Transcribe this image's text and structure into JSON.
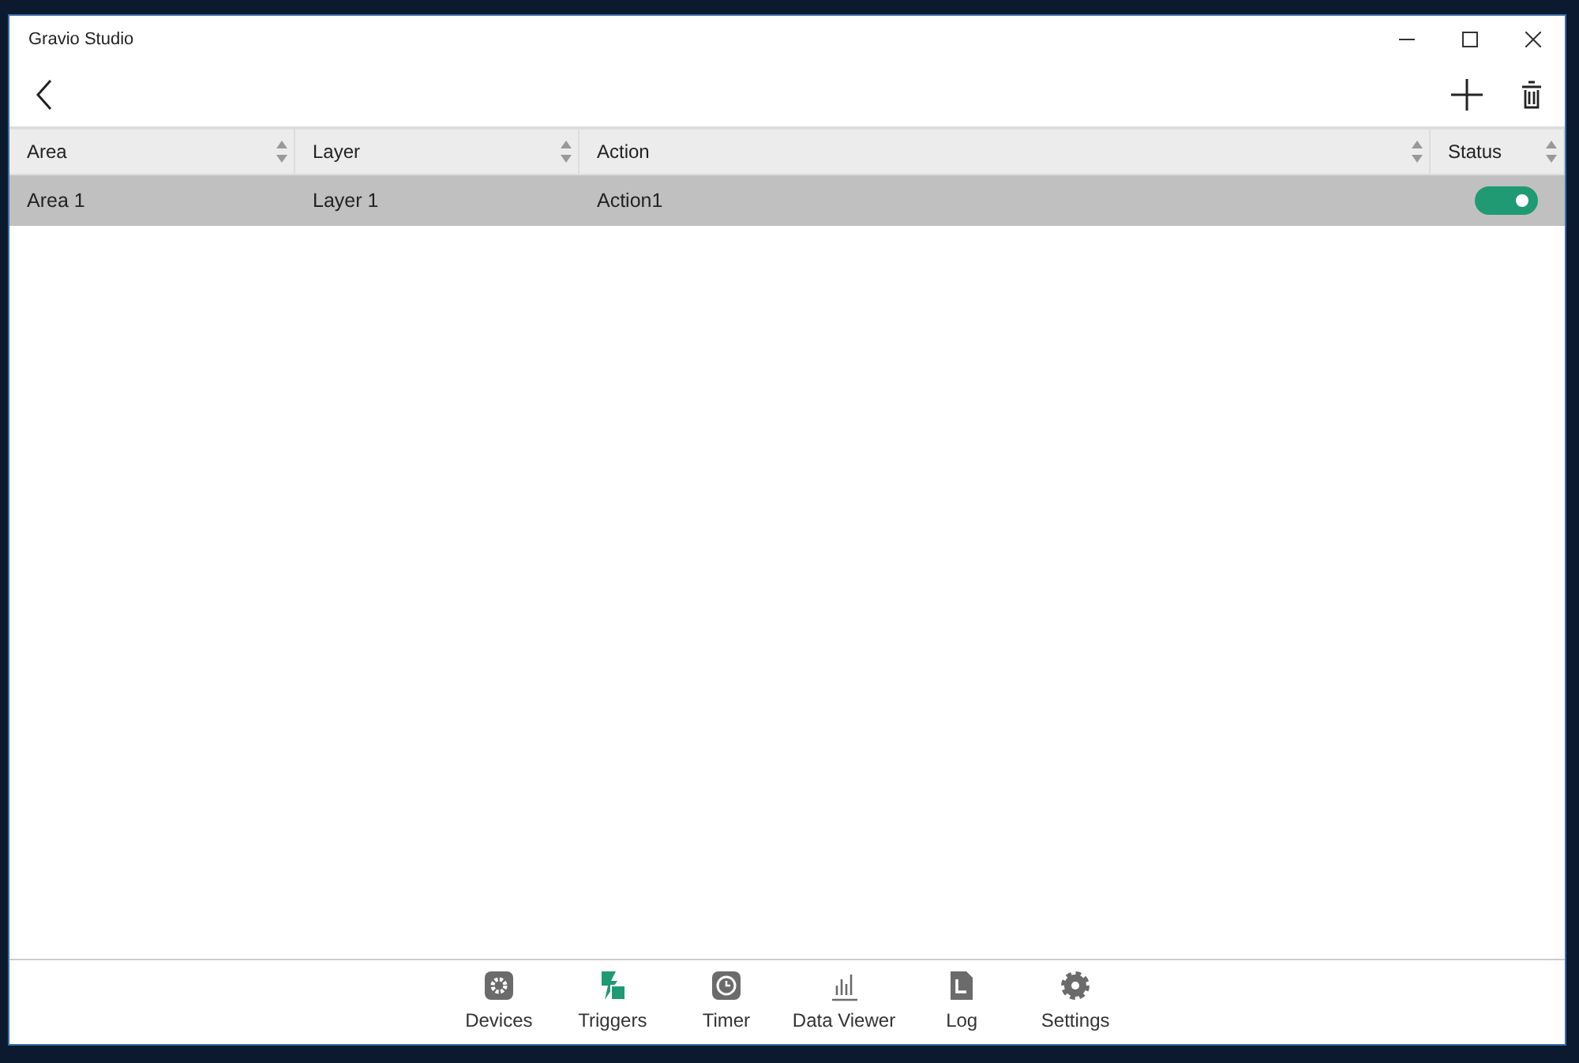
{
  "window": {
    "title": "Gravio Studio"
  },
  "table": {
    "columns": [
      "Area",
      "Layer",
      "Action",
      "Status"
    ],
    "rows": [
      {
        "cells": [
          "Area 1",
          "Layer 1",
          "Action1"
        ],
        "status_on": true,
        "selected": true
      }
    ]
  },
  "nav": [
    {
      "label": "Devices",
      "kind": "devices",
      "selected": false
    },
    {
      "label": "Triggers",
      "kind": "triggers",
      "selected": true
    },
    {
      "label": "Timer",
      "kind": "timer",
      "selected": false
    },
    {
      "label": "Data Viewer",
      "kind": "dataviewer",
      "selected": false
    },
    {
      "label": "Log",
      "kind": "log",
      "selected": false
    },
    {
      "label": "Settings",
      "kind": "settings",
      "selected": false
    }
  ]
}
